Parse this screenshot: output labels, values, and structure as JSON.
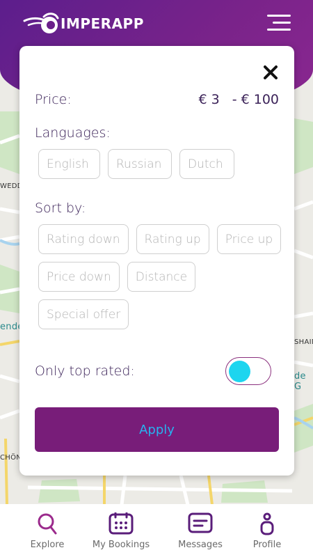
{
  "app": {
    "name": "IMPERAPP",
    "brand_color": "#6a1f8a",
    "accent_color": "#781d79",
    "toggle_color": "#1dd5ef"
  },
  "map": {
    "labels": {
      "weddi": "WEDDIN",
      "ender": "ender",
      "shaim": "SHAIM",
      "de_g": "de G",
      "chone": "CHÖNE"
    }
  },
  "filter": {
    "price_label": "Price:",
    "price_min": "€ 3",
    "price_max": "- € 100",
    "languages_label": "Languages:",
    "languages": [
      "English",
      "Russian",
      "Dutch"
    ],
    "sort_label": "Sort by:",
    "sort_options": [
      "Rating down",
      "Rating up",
      "Price up",
      "Price down",
      "Distance",
      "Special offer"
    ],
    "top_rated_label": "Only top rated:",
    "top_rated_on": false,
    "apply_label": "Apply"
  },
  "nav": {
    "items": [
      {
        "label": "Explore",
        "icon": "search-icon",
        "active": true
      },
      {
        "label": "My Bookings",
        "icon": "calendar-icon",
        "active": false
      },
      {
        "label": "Messages",
        "icon": "message-icon",
        "active": false
      },
      {
        "label": "Profile",
        "icon": "person-icon",
        "active": false
      }
    ]
  }
}
